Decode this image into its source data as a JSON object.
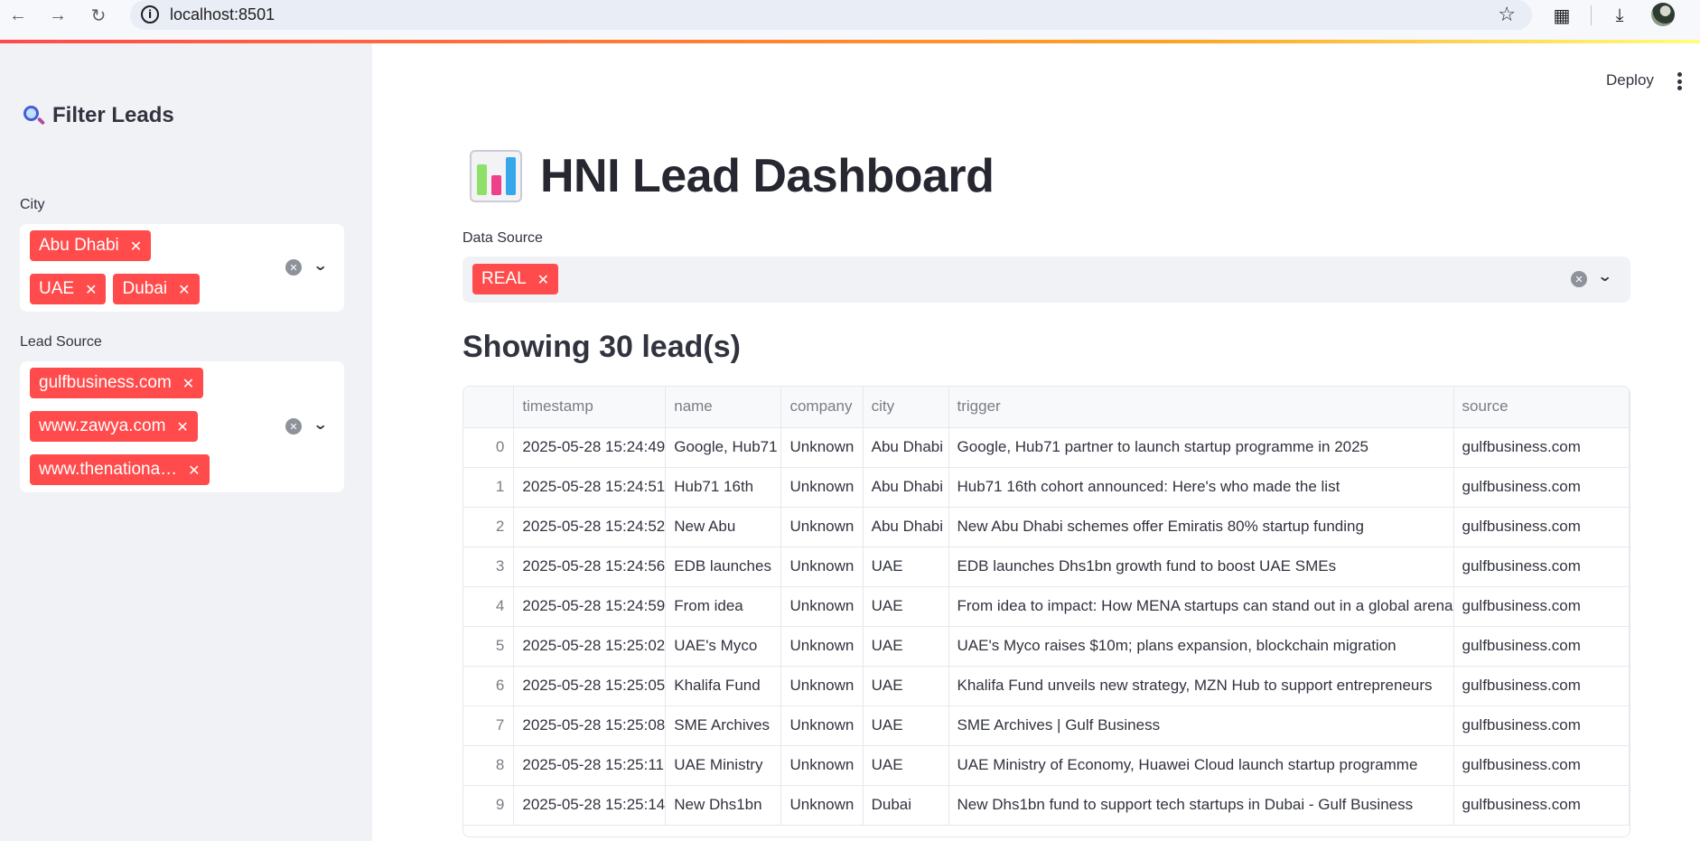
{
  "browser": {
    "url": "localhost:8501"
  },
  "sidebar": {
    "header": "Filter Leads",
    "city": {
      "label": "City",
      "tags": [
        "Abu Dhabi",
        "UAE",
        "Dubai"
      ]
    },
    "lead_source": {
      "label": "Lead Source",
      "tags": [
        "gulfbusiness.com",
        "www.zawya.com",
        "www.thenationa…"
      ]
    }
  },
  "toolbar": {
    "deploy_label": "Deploy"
  },
  "main": {
    "title": "HNI Lead Dashboard",
    "data_source": {
      "label": "Data Source",
      "tags": [
        "REAL"
      ]
    },
    "subheader": "Showing 30 lead(s)",
    "table": {
      "columns": [
        "",
        "timestamp",
        "name",
        "company",
        "city",
        "trigger",
        "source"
      ],
      "rows": [
        [
          "0",
          "2025-05-28 15:24:49",
          "Google, Hub71",
          "Unknown",
          "Abu Dhabi",
          "Google, Hub71 partner to launch startup programme in 2025",
          "gulfbusiness.com"
        ],
        [
          "1",
          "2025-05-28 15:24:51",
          "Hub71 16th",
          "Unknown",
          "Abu Dhabi",
          "Hub71 16th cohort announced: Here's who made the list",
          "gulfbusiness.com"
        ],
        [
          "2",
          "2025-05-28 15:24:52",
          "New Abu",
          "Unknown",
          "Abu Dhabi",
          "New Abu Dhabi schemes offer Emiratis 80% startup funding",
          "gulfbusiness.com"
        ],
        [
          "3",
          "2025-05-28 15:24:56",
          "EDB launches",
          "Unknown",
          "UAE",
          "EDB launches Dhs1bn growth fund to boost UAE SMEs",
          "gulfbusiness.com"
        ],
        [
          "4",
          "2025-05-28 15:24:59",
          "From idea",
          "Unknown",
          "UAE",
          "From idea to impact: How MENA startups can stand out in a global arena",
          "gulfbusiness.com"
        ],
        [
          "5",
          "2025-05-28 15:25:02",
          "UAE's Myco",
          "Unknown",
          "UAE",
          "UAE's Myco raises $10m; plans expansion, blockchain migration",
          "gulfbusiness.com"
        ],
        [
          "6",
          "2025-05-28 15:25:05",
          "Khalifa Fund",
          "Unknown",
          "UAE",
          "Khalifa Fund unveils new strategy, MZN Hub to support entrepreneurs",
          "gulfbusiness.com"
        ],
        [
          "7",
          "2025-05-28 15:25:08",
          "SME Archives",
          "Unknown",
          "UAE",
          "SME Archives | Gulf Business",
          "gulfbusiness.com"
        ],
        [
          "8",
          "2025-05-28 15:25:11",
          "UAE Ministry",
          "Unknown",
          "UAE",
          "UAE Ministry of Economy, Huawei Cloud launch startup programme",
          "gulfbusiness.com"
        ],
        [
          "9",
          "2025-05-28 15:25:14",
          "New Dhs1bn",
          "Unknown",
          "Dubai",
          "New Dhs1bn fund to support tech startups in Dubai - Gulf Business",
          "gulfbusiness.com"
        ]
      ]
    }
  },
  "colors": {
    "accent": "#ff4b4b",
    "sidebar_bg": "#f0f2f6"
  }
}
